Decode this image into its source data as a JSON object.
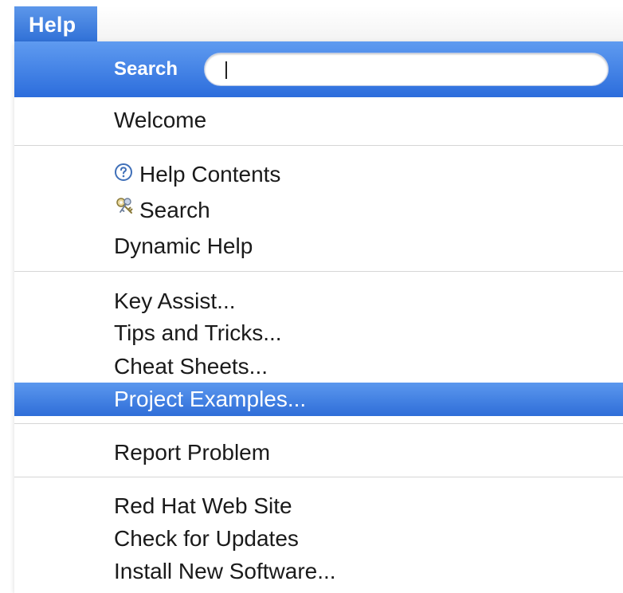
{
  "menubar": {
    "active_menu": "Help"
  },
  "search": {
    "label": "Search",
    "value": "",
    "placeholder": ""
  },
  "menu": {
    "welcome": "Welcome",
    "help_contents": "Help Contents",
    "search_item": "Search",
    "dynamic_help": "Dynamic Help",
    "key_assist": "Key Assist...",
    "tips_and_tricks": "Tips and Tricks...",
    "cheat_sheets": "Cheat Sheets...",
    "project_examples": "Project Examples...",
    "report_problem": "Report Problem",
    "red_hat_web_site": "Red Hat Web Site",
    "check_for_updates": "Check for Updates",
    "install_new_software": "Install New Software..."
  },
  "icons": {
    "help_contents": "question-circle-icon",
    "search_item": "keys-icon"
  },
  "colors": {
    "selection": "#3a7be0",
    "menu_background": "#ffffff",
    "separator": "#d6d6d6"
  },
  "selected_item": "Project Examples..."
}
